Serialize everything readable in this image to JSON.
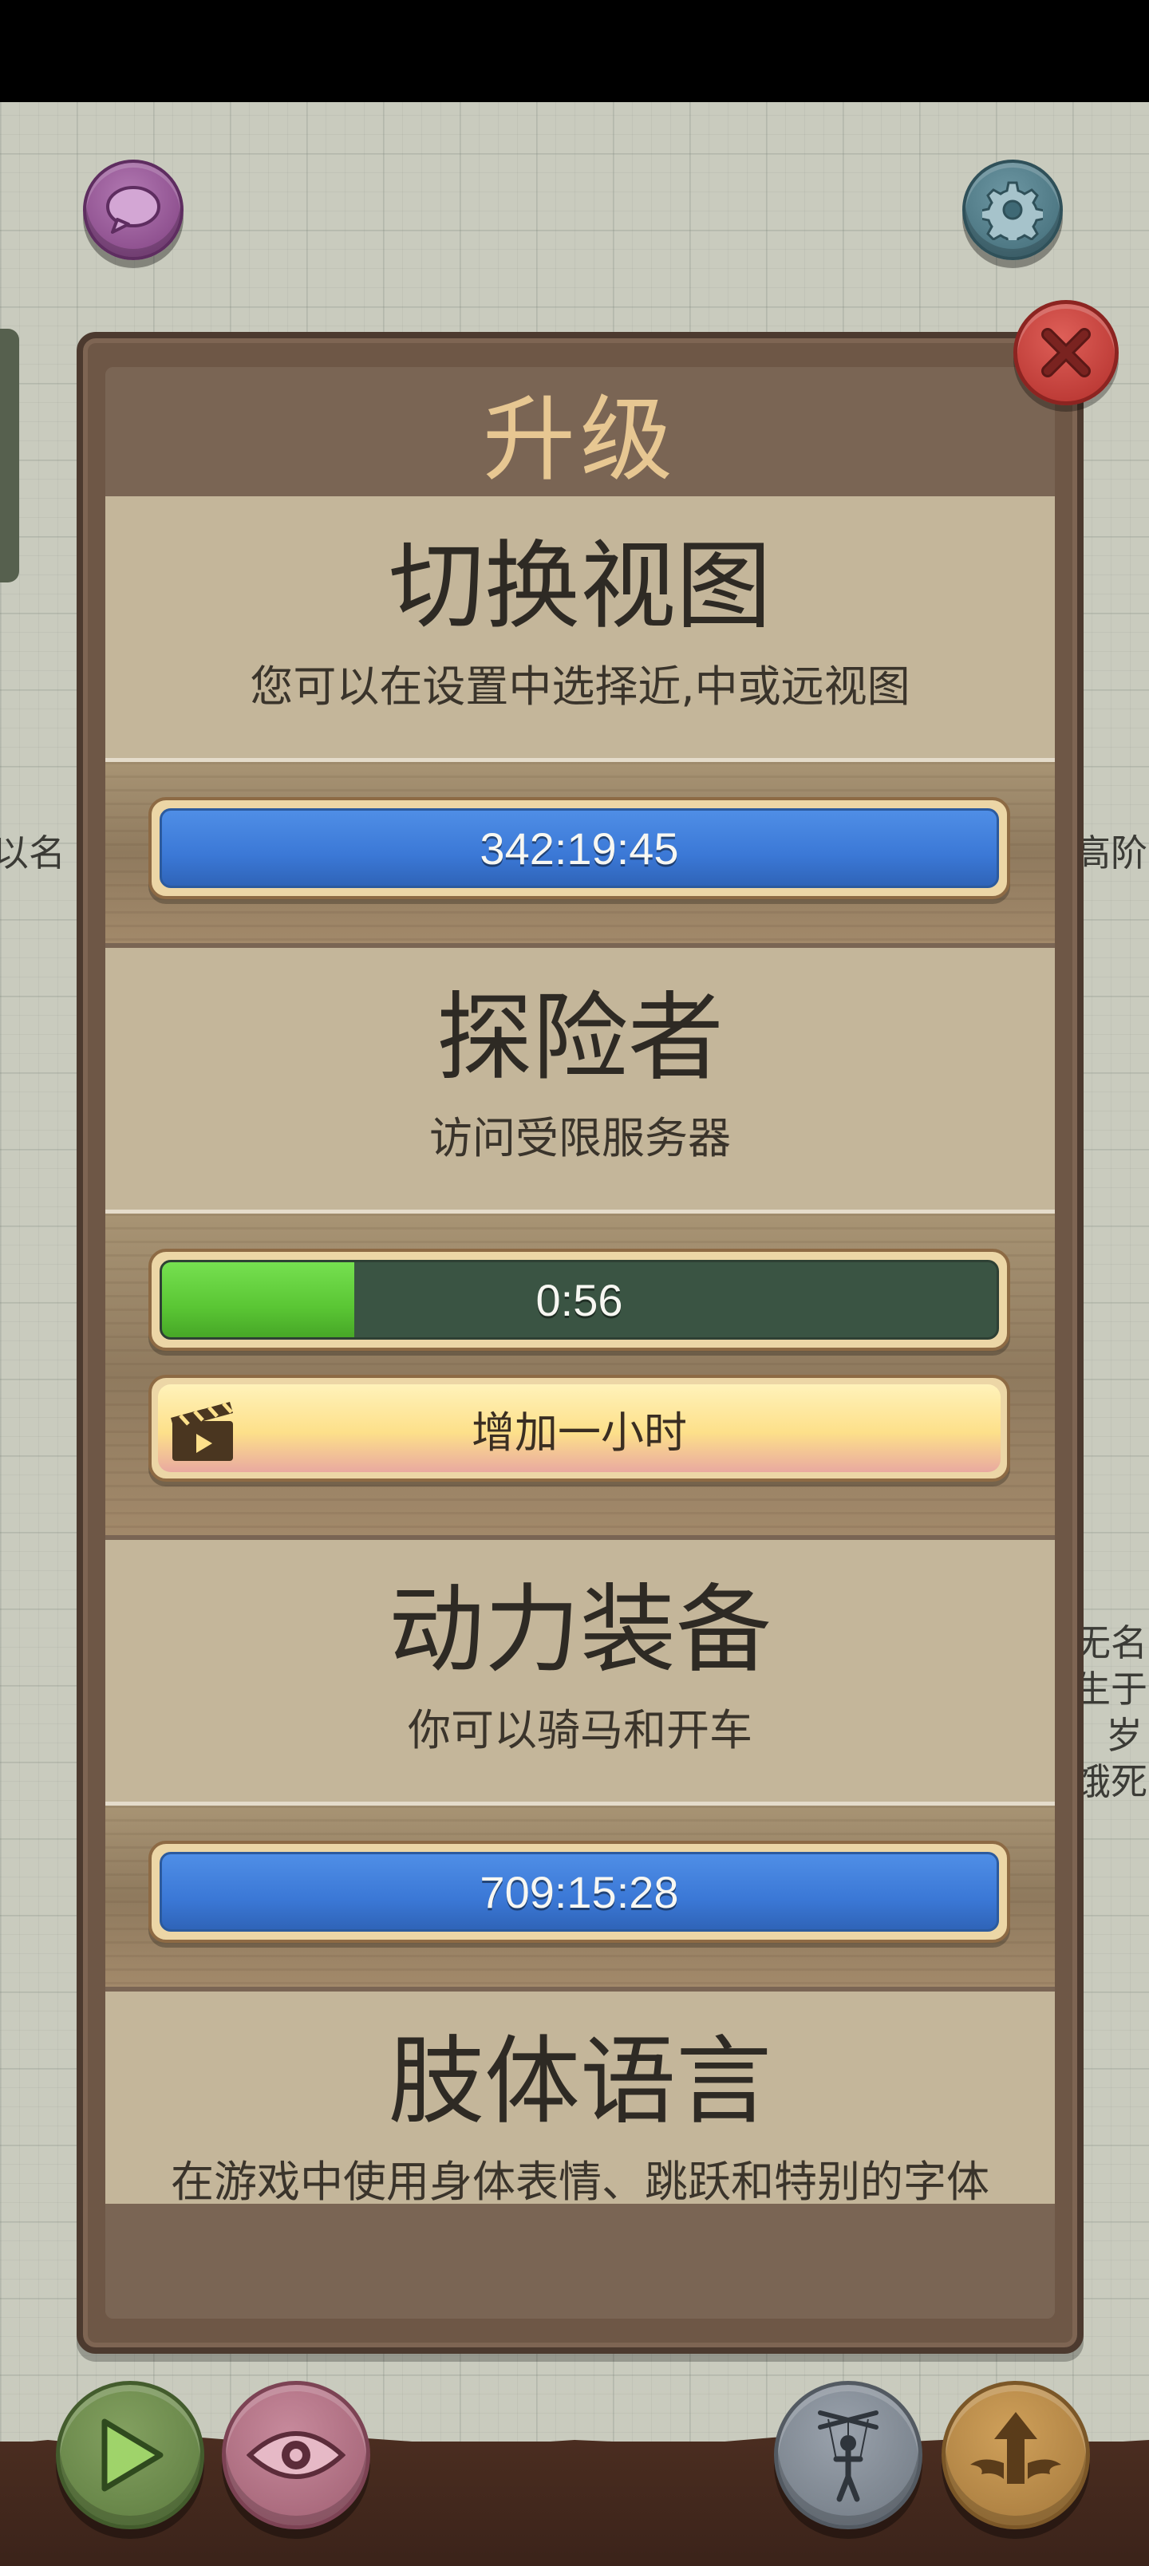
{
  "panel": {
    "title": "升级"
  },
  "upgrades": [
    {
      "title": "切换视图",
      "description": "您可以在设置中选择近,中或远视图",
      "timer": "342:19:45"
    },
    {
      "title": "探险者",
      "description": "访问受限服务器",
      "timer": "0:56",
      "progress_fraction": 0.23,
      "add_button_label": "增加一小时"
    },
    {
      "title": "动力装备",
      "description": "你可以骑马和开车",
      "timer": "709:15:28"
    },
    {
      "title": "肢体语言",
      "description": "在游戏中使用身体表情、跳跃和特别的字体"
    }
  ],
  "background": {
    "left_text": "以名",
    "right_text": "高阶",
    "right_stack": [
      "无名",
      "生于",
      "岁",
      "饿死"
    ]
  },
  "icons": {
    "chat": "chat-bubble-icon",
    "settings": "gear-icon",
    "close": "close-x-icon",
    "clapper": "clapperboard-icon",
    "play": "play-icon",
    "eye": "eye-icon",
    "puppet": "puppet-icon",
    "upgrade": "winged-arrow-icon"
  },
  "colors": {
    "timer_blue": "#3b78d6",
    "progress_green": "#5ac634",
    "title_gold": "#e7c792",
    "close_red": "#c23b35"
  }
}
